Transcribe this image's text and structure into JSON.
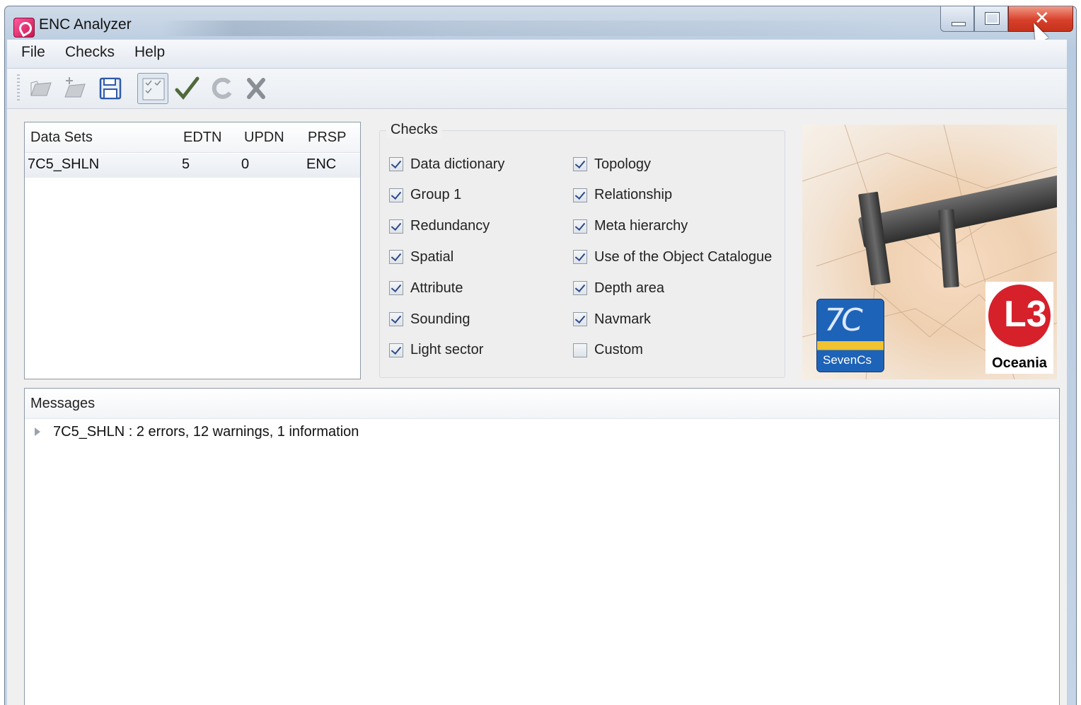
{
  "window": {
    "title": "ENC Analyzer",
    "close_glyph": "✕"
  },
  "menu": [
    "File",
    "Checks",
    "Help"
  ],
  "toolbar": {
    "icons": [
      "open-folder-icon",
      "add-folder-icon",
      "save-icon",
      "select-all-icon",
      "check-icon",
      "refresh-icon",
      "close-icon"
    ]
  },
  "datasets": {
    "columns": [
      "Data Sets",
      "EDTN",
      "UPDN",
      "PRSP"
    ],
    "rows": [
      {
        "name": "7C5_SHLN",
        "edtn": "5",
        "updn": "0",
        "prsp": "ENC"
      }
    ]
  },
  "checks": {
    "title": "Checks",
    "left": [
      {
        "label": "Data dictionary",
        "checked": true
      },
      {
        "label": "Group 1",
        "checked": true
      },
      {
        "label": "Redundancy",
        "checked": true
      },
      {
        "label": "Spatial",
        "checked": true
      },
      {
        "label": "Attribute",
        "checked": true
      },
      {
        "label": "Sounding",
        "checked": true
      },
      {
        "label": "Light sector",
        "checked": true
      }
    ],
    "right": [
      {
        "label": "Topology",
        "checked": true
      },
      {
        "label": "Relationship",
        "checked": true
      },
      {
        "label": "Meta hierarchy",
        "checked": true
      },
      {
        "label": "Use of the Object Catalogue",
        "checked": true
      },
      {
        "label": "Depth area",
        "checked": true
      },
      {
        "label": "Navmark",
        "checked": true
      },
      {
        "label": "Custom",
        "checked": false
      }
    ]
  },
  "logos": {
    "sevencs_big": "7C",
    "sevencs_small": "SevenCs",
    "l3_mark": "L3",
    "l3_caption": "Oceania"
  },
  "messages": {
    "title": "Messages",
    "items": [
      "7C5_SHLN : 2 errors, 12 warnings, 1 information"
    ]
  },
  "colors": {
    "accent_red": "#d6202a",
    "sevencs_blue": "#1d63b8",
    "check_mark": "#2c4a8a"
  }
}
